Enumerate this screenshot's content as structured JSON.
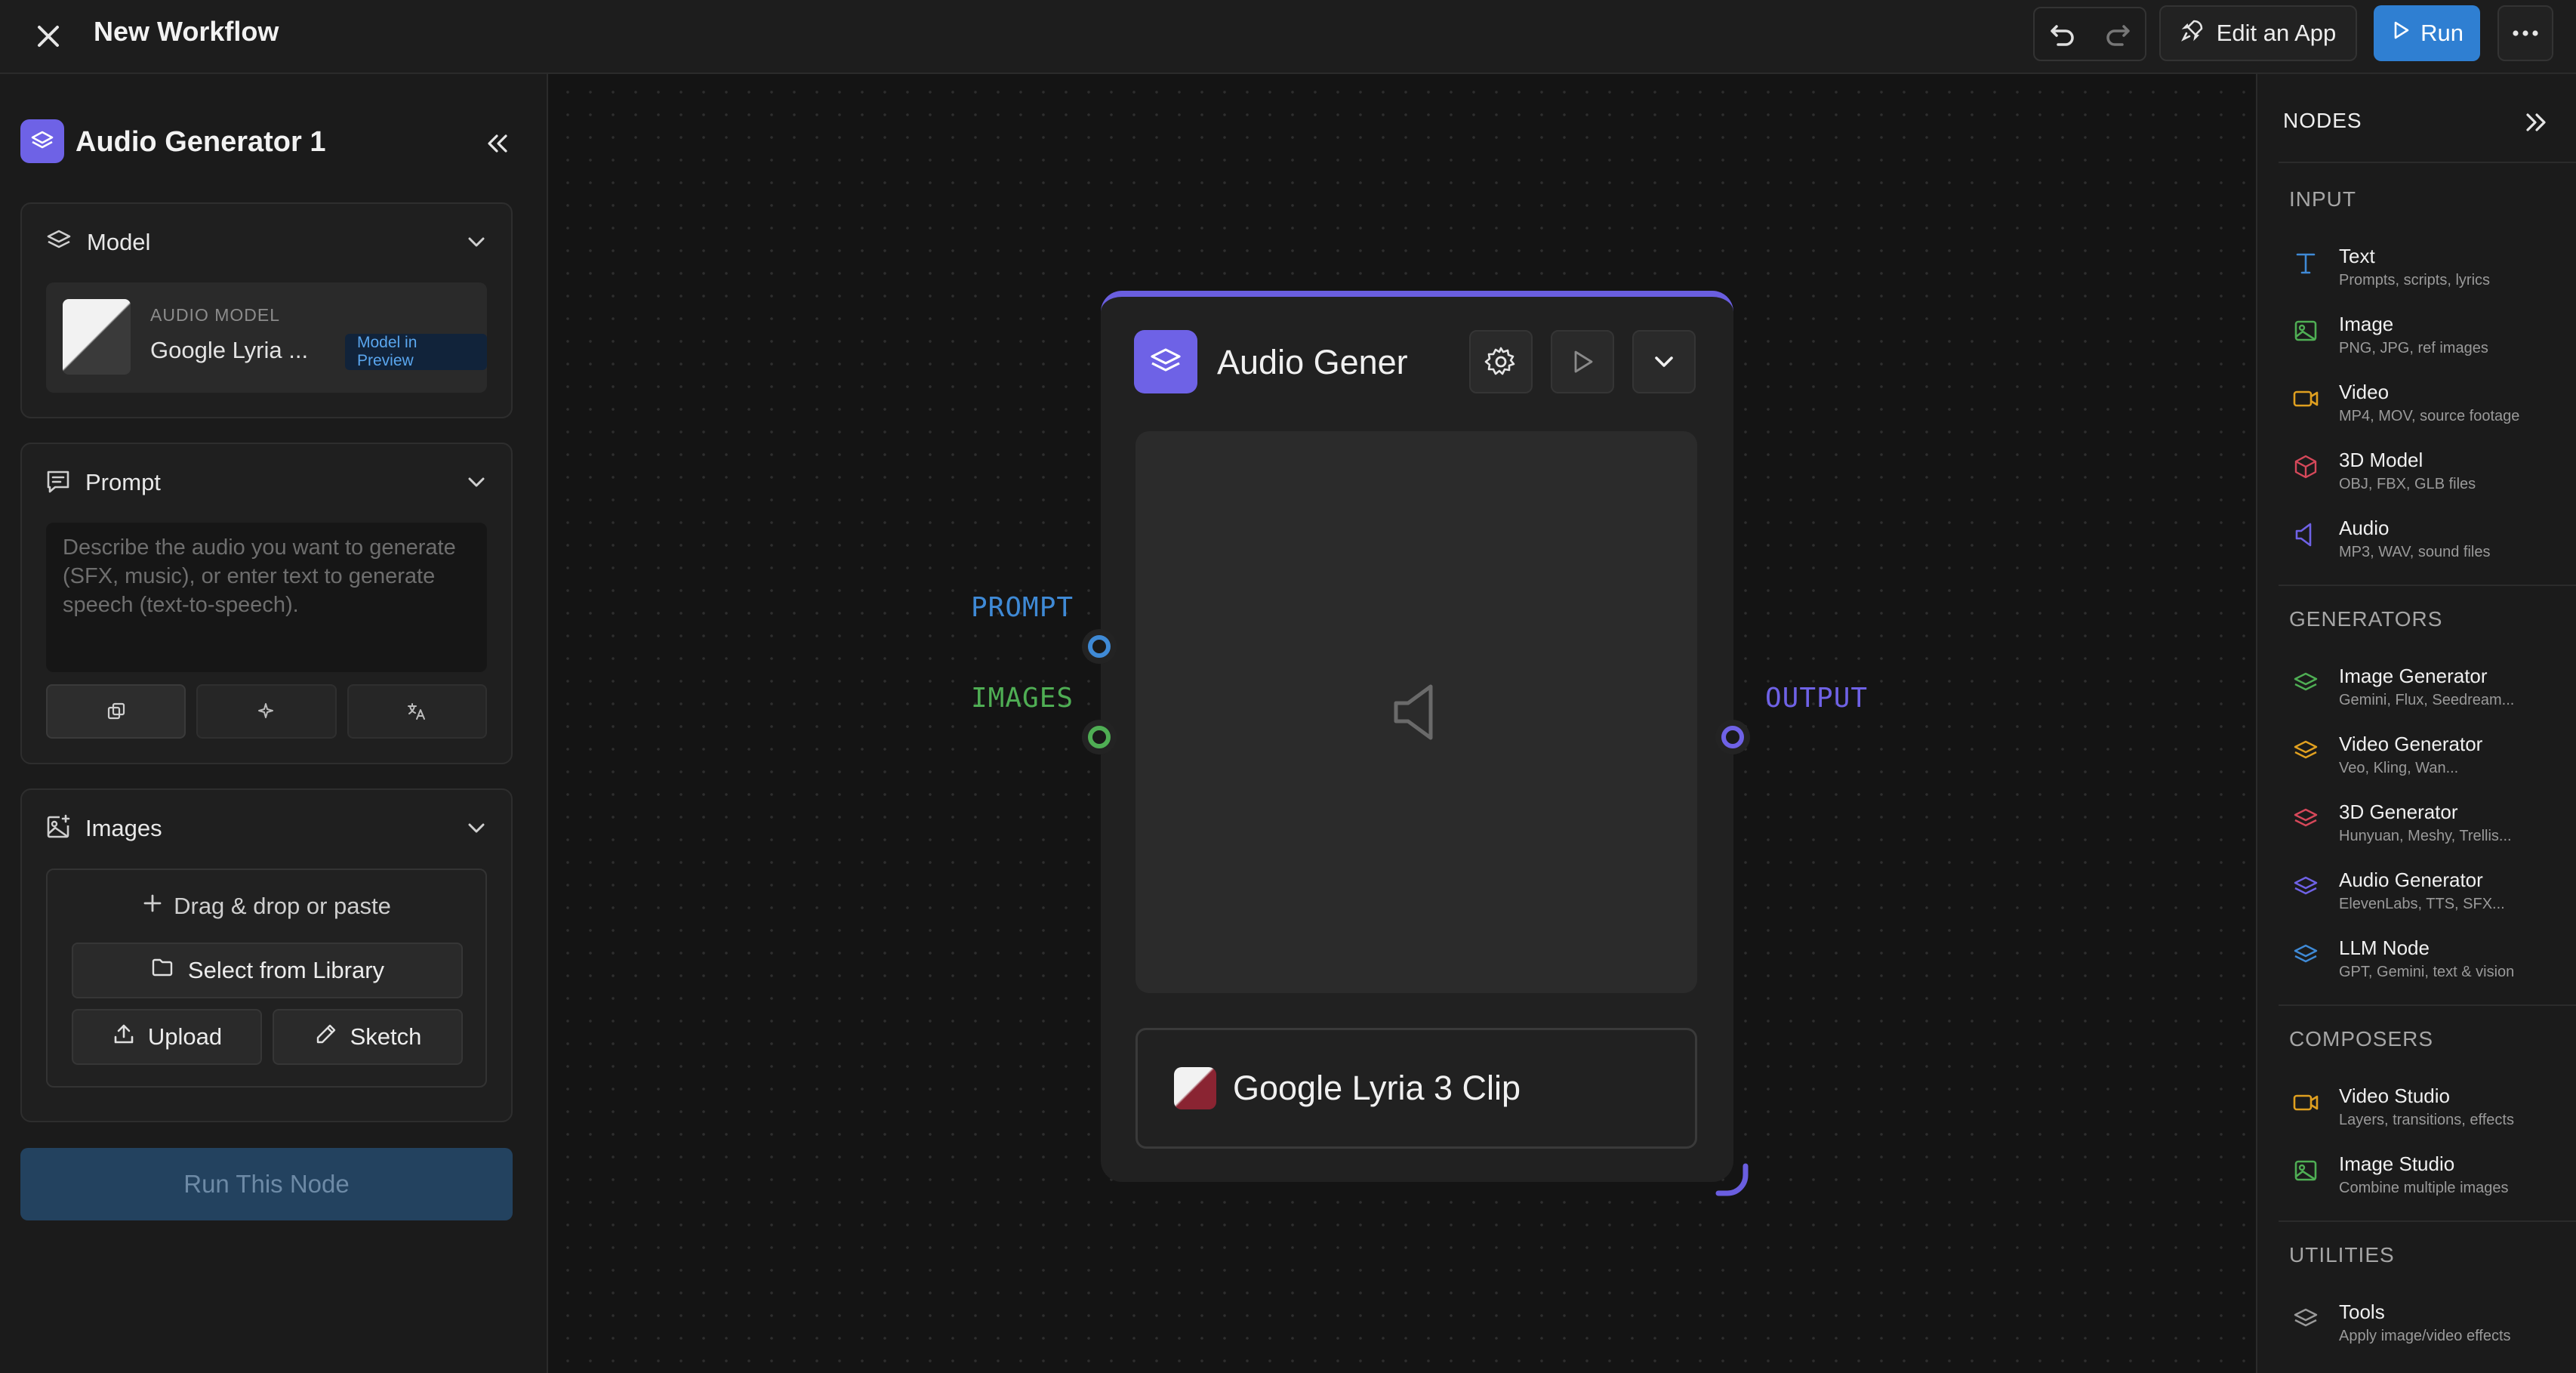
{
  "topbar": {
    "title": "New Workflow",
    "edit_app_label": "Edit an App",
    "run_label": "Run"
  },
  "left_panel": {
    "title": "Audio Generator 1",
    "model_section": {
      "label": "Model",
      "caption": "AUDIO MODEL",
      "model_name": "Google Lyria ...",
      "badge": "Model in Preview"
    },
    "prompt_section": {
      "label": "Prompt",
      "placeholder": "Describe the audio you want to generate (SFX, music), or enter text to generate speech (text-to-speech).",
      "value": ""
    },
    "images_section": {
      "label": "Images",
      "drop_text": "Drag & drop or paste",
      "library_label": "Select from Library",
      "upload_label": "Upload",
      "sketch_label": "Sketch"
    },
    "run_node_label": "Run This Node"
  },
  "canvas": {
    "node": {
      "title": "Audio Gener",
      "model_name": "Google Lyria 3 Clip",
      "inputs": [
        {
          "label": "PROMPT",
          "color": "#3f8ad6"
        },
        {
          "label": "IMAGES",
          "color": "#4fae54"
        }
      ],
      "output": {
        "label": "OUTPUT",
        "color": "#6f62e6"
      },
      "accent_color": "#6a5ee0"
    }
  },
  "right_panel": {
    "title": "NODES",
    "sections": [
      {
        "title": "INPUT",
        "items": [
          {
            "name": "Text",
            "desc": "Prompts, scripts, lyrics",
            "icon": "text-icon",
            "color": "#3f8ad6"
          },
          {
            "name": "Image",
            "desc": "PNG, JPG, ref images",
            "icon": "image-icon",
            "color": "#4fae54"
          },
          {
            "name": "Video",
            "desc": "MP4, MOV, source footage",
            "icon": "video-icon",
            "color": "#e0a020"
          },
          {
            "name": "3D Model",
            "desc": "OBJ, FBX, GLB files",
            "icon": "cube-icon",
            "color": "#d6485a"
          },
          {
            "name": "Audio",
            "desc": "MP3, WAV, sound files",
            "icon": "speaker-icon",
            "color": "#6f62e6"
          }
        ]
      },
      {
        "title": "GENERATORS",
        "items": [
          {
            "name": "Image Generator",
            "desc": "Gemini, Flux, Seedream...",
            "icon": "layers-icon",
            "color": "#4fae54"
          },
          {
            "name": "Video Generator",
            "desc": "Veo, Kling, Wan...",
            "icon": "layers-icon",
            "color": "#e0a020"
          },
          {
            "name": "3D Generator",
            "desc": "Hunyuan, Meshy, Trellis...",
            "icon": "layers-icon",
            "color": "#d6485a"
          },
          {
            "name": "Audio Generator",
            "desc": "ElevenLabs, TTS, SFX...",
            "icon": "layers-icon",
            "color": "#6f62e6"
          },
          {
            "name": "LLM Node",
            "desc": "GPT, Gemini, text & vision",
            "icon": "layers-icon",
            "color": "#3f8ad6"
          }
        ]
      },
      {
        "title": "COMPOSERS",
        "items": [
          {
            "name": "Video Studio",
            "desc": "Layers, transitions, effects",
            "icon": "video-icon",
            "color": "#e0a020"
          },
          {
            "name": "Image Studio",
            "desc": "Combine multiple images",
            "icon": "image-icon",
            "color": "#4fae54"
          }
        ]
      },
      {
        "title": "UTILITIES",
        "items": [
          {
            "name": "Tools",
            "desc": "Apply image/video effects",
            "icon": "layers-icon",
            "color": "#9a9a9a"
          }
        ]
      }
    ]
  }
}
